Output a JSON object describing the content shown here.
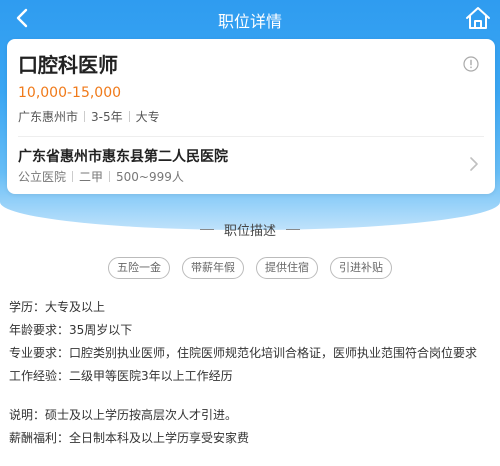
{
  "nav": {
    "title": "职位详情",
    "back_icon": "back-arrow-icon",
    "home_icon": "home-icon"
  },
  "job": {
    "title": "口腔科医师",
    "salary": "10,000-15,000",
    "location": "广东惠州市",
    "experience": "3-5年",
    "education": "大专"
  },
  "company": {
    "name": "广东省惠州市惠东县第二人民医院",
    "type": "公立医院",
    "level": "二甲",
    "size": "500~999人"
  },
  "section": {
    "title": "职位描述"
  },
  "benefits": [
    "五险一金",
    "带薪年假",
    "提供住宿",
    "引进补贴"
  ],
  "description": {
    "lines": [
      "学历：大专及以上",
      "年龄要求：35周岁以下",
      "专业要求：口腔类别执业医师，住院医师规范化培训合格证，医师执业范围符合岗位要求",
      "工作经验：二级甲等医院3年以上工作经历"
    ],
    "notes": [
      "说明：硕士及以上学历按高层次人才引进。",
      "薪酬福利：全日制本科及以上学历享受安家费"
    ]
  },
  "colors": {
    "header_blue": "#2f9cf0",
    "salary_orange": "#f07a1a"
  }
}
